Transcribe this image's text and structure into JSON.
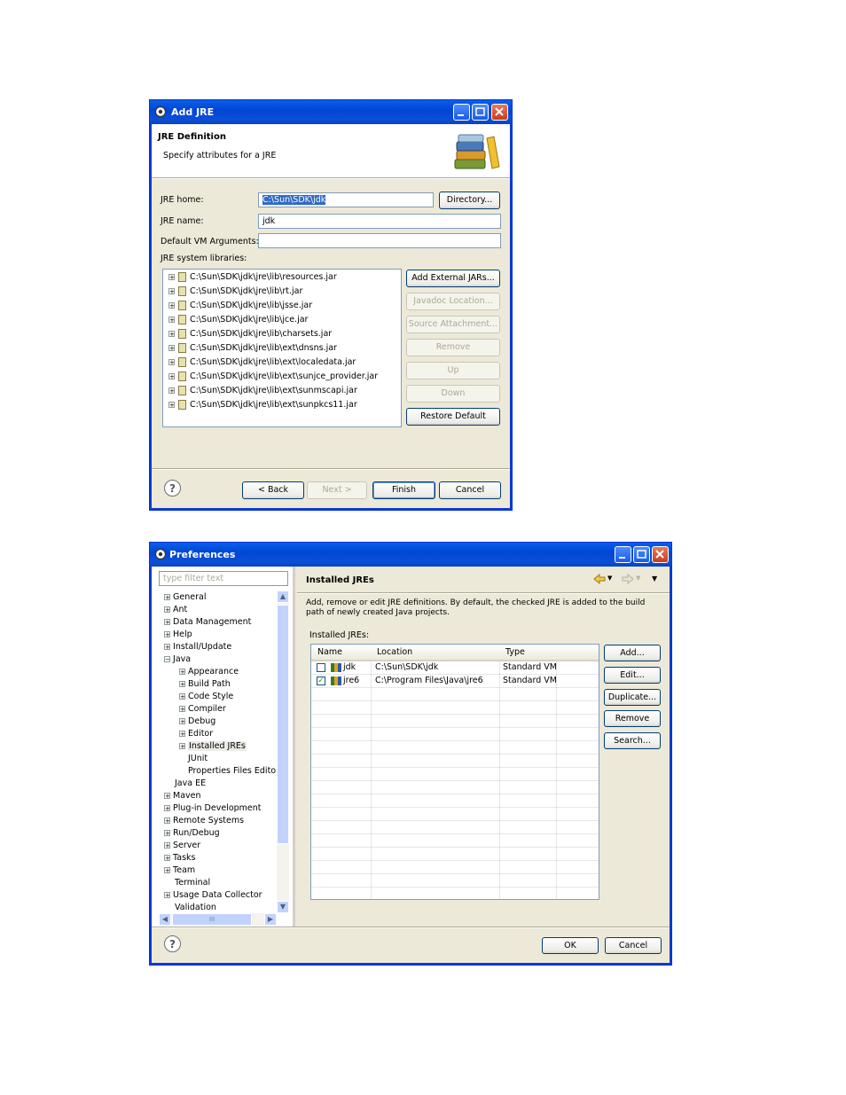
{
  "add_jre": {
    "title": "Add JRE",
    "header_title": "JRE Definition",
    "header_subtitle": "Specify attributes for a JRE",
    "jre_home_label": "JRE home:",
    "jre_home_value": "C:\\Sun\\SDK\\jdk",
    "directory_button": "Directory...",
    "jre_name_label": "JRE name:",
    "jre_name_value": "jdk",
    "vm_args_label": "Default VM Arguments:",
    "vm_args_value": "",
    "libs_label": "JRE system libraries:",
    "libraries": [
      "C:\\Sun\\SDK\\jdk\\jre\\lib\\resources.jar",
      "C:\\Sun\\SDK\\jdk\\jre\\lib\\rt.jar",
      "C:\\Sun\\SDK\\jdk\\jre\\lib\\jsse.jar",
      "C:\\Sun\\SDK\\jdk\\jre\\lib\\jce.jar",
      "C:\\Sun\\SDK\\jdk\\jre\\lib\\charsets.jar",
      "C:\\Sun\\SDK\\jdk\\jre\\lib\\ext\\dnsns.jar",
      "C:\\Sun\\SDK\\jdk\\jre\\lib\\ext\\localedata.jar",
      "C:\\Sun\\SDK\\jdk\\jre\\lib\\ext\\sunjce_provider.jar",
      "C:\\Sun\\SDK\\jdk\\jre\\lib\\ext\\sunmscapi.jar",
      "C:\\Sun\\SDK\\jdk\\jre\\lib\\ext\\sunpkcs11.jar"
    ],
    "side_buttons": {
      "add_external": "Add External JARs...",
      "javadoc": "Javadoc Location...",
      "source": "Source Attachment...",
      "remove": "Remove",
      "up": "Up",
      "down": "Down",
      "restore": "Restore Default"
    },
    "footer": {
      "back": "< Back",
      "next": "Next >",
      "finish": "Finish",
      "cancel": "Cancel"
    }
  },
  "preferences": {
    "title": "Preferences",
    "filter_placeholder": "type filter text",
    "tree": {
      "general": "General",
      "ant": "Ant",
      "data_management": "Data Management",
      "help": "Help",
      "install_update": "Install/Update",
      "java": "Java",
      "appearance": "Appearance",
      "build_path": "Build Path",
      "code_style": "Code Style",
      "compiler": "Compiler",
      "debug": "Debug",
      "editor": "Editor",
      "installed_jres": "Installed JREs",
      "junit": "JUnit",
      "properties_files_editor": "Properties Files Editor",
      "java_ee": "Java EE",
      "maven": "Maven",
      "plugin_development": "Plug-in Development",
      "remote_systems": "Remote Systems",
      "run_debug": "Run/Debug",
      "server": "Server",
      "tasks": "Tasks",
      "team": "Team",
      "terminal": "Terminal",
      "usage_data_collector": "Usage Data Collector",
      "validation": "Validation"
    },
    "page_title": "Installed JREs",
    "description": "Add, remove or edit JRE definitions. By default, the checked JRE is added to the build path of newly created Java projects.",
    "installed_label": "Installed JREs:",
    "columns": {
      "name": "Name",
      "location": "Location",
      "type": "Type"
    },
    "rows": [
      {
        "name": "jdk",
        "location": "C:\\Sun\\SDK\\jdk",
        "type": "Standard VM",
        "checked": false
      },
      {
        "name": "jre6",
        "location": "C:\\Program Files\\Java\\jre6",
        "type": "Standard VM",
        "checked": true
      }
    ],
    "buttons": {
      "add": "Add...",
      "edit": "Edit...",
      "duplicate": "Duplicate...",
      "remove": "Remove",
      "search": "Search..."
    },
    "footer": {
      "ok": "OK",
      "cancel": "Cancel"
    },
    "scroll_mark": "III"
  }
}
